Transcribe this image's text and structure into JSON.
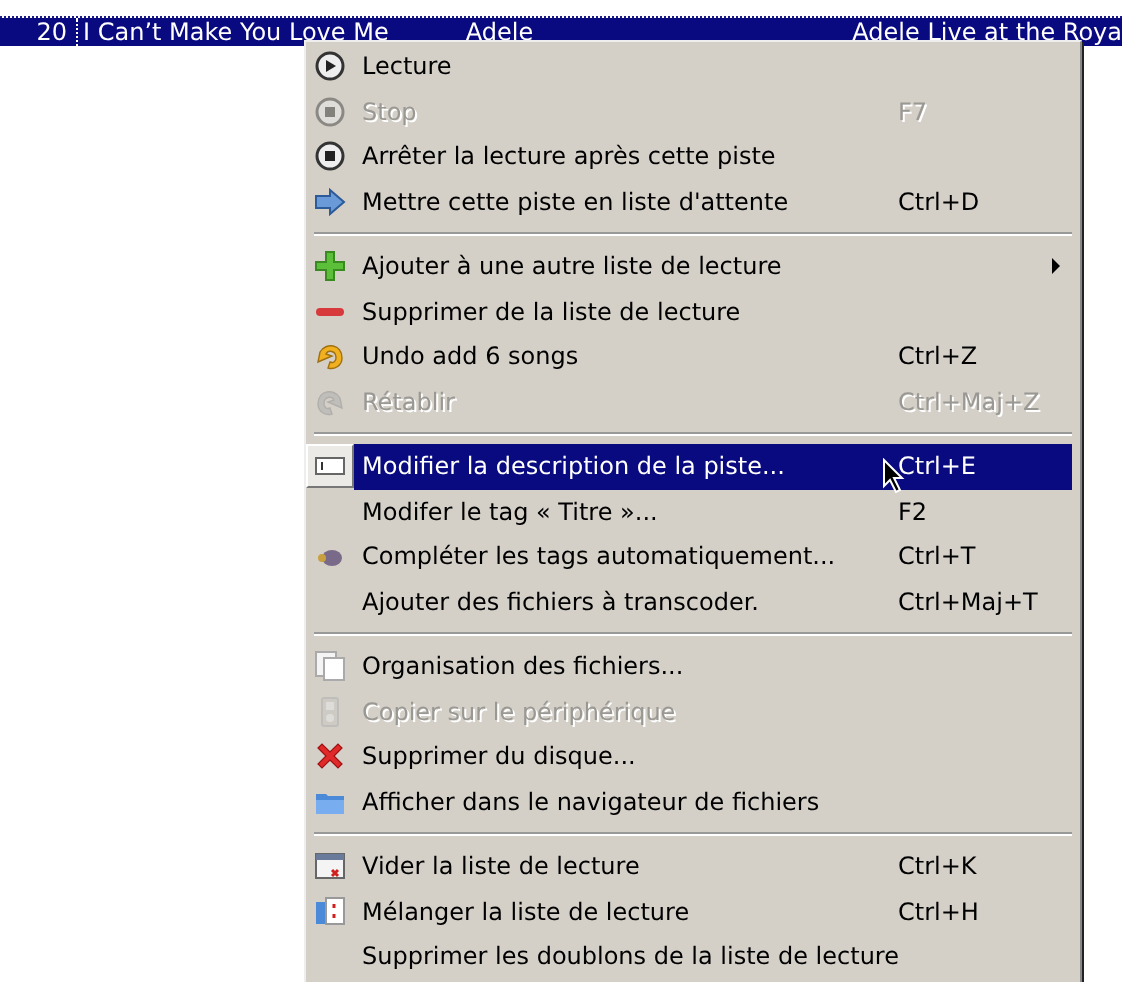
{
  "track_row": {
    "number": "20",
    "title": "I Can’t Make You Love Me",
    "artist": "Adele",
    "album": "Adele Live at the Roya",
    "selected": true
  },
  "menu": {
    "sections": [
      {
        "items": [
          {
            "kind": "play",
            "label": "Lecture",
            "disabled": false,
            "selected": false
          },
          {
            "kind": "stop",
            "label": "Stop",
            "shortcut": "F7",
            "disabled": true,
            "selected": false
          },
          {
            "kind": "stop-after",
            "label": "Arrêter la lecture après cette piste",
            "disabled": false,
            "selected": false
          },
          {
            "kind": "queue",
            "label": "Mettre cette piste en liste d'attente",
            "shortcut": "Ctrl+D",
            "disabled": false,
            "selected": false
          }
        ]
      },
      {
        "items": [
          {
            "kind": "add",
            "label": "Ajouter à une autre liste de lecture",
            "submenu": true,
            "disabled": false,
            "selected": false
          },
          {
            "kind": "remove",
            "label": "Supprimer de la liste de lecture",
            "disabled": false,
            "selected": false
          },
          {
            "kind": "undo",
            "label": "Undo add 6 songs",
            "shortcut": "Ctrl+Z",
            "disabled": false,
            "selected": false
          },
          {
            "kind": "redo",
            "label": "Rétablir",
            "shortcut": "Ctrl+Maj+Z",
            "disabled": true,
            "selected": false
          }
        ]
      },
      {
        "items": [
          {
            "kind": "edit",
            "label": "Modifier la description de la piste...",
            "shortcut": "Ctrl+E",
            "disabled": false,
            "selected": true
          },
          {
            "label": "Modifer le tag « Titre »...",
            "shortcut": "F2",
            "disabled": false,
            "selected": false
          },
          {
            "kind": "wand",
            "label": "Compléter les tags automatiquement...",
            "shortcut": "Ctrl+T",
            "disabled": false,
            "selected": false
          },
          {
            "label": "Ajouter des fichiers à transcoder.",
            "shortcut": "Ctrl+Maj+T",
            "disabled": false,
            "selected": false
          }
        ]
      },
      {
        "items": [
          {
            "kind": "copy",
            "label": "Organisation des fichiers...",
            "disabled": false,
            "selected": false
          },
          {
            "kind": "device",
            "label": "Copier sur le périphérique",
            "disabled": true,
            "selected": false
          },
          {
            "kind": "delete",
            "label": "Supprimer du disque...",
            "disabled": false,
            "selected": false
          },
          {
            "kind": "folder",
            "label": "Afficher dans le navigateur de fichiers",
            "disabled": false,
            "selected": false
          }
        ]
      },
      {
        "items": [
          {
            "kind": "clear",
            "label": "Vider la liste de lecture",
            "shortcut": "Ctrl+K",
            "disabled": false,
            "selected": false
          },
          {
            "kind": "shuffle",
            "label": "Mélanger la liste de lecture",
            "shortcut": "Ctrl+H",
            "disabled": false,
            "selected": false
          },
          {
            "label": "Supprimer les doublons de la liste de lecture",
            "disabled": false,
            "selected": false
          }
        ]
      }
    ]
  }
}
